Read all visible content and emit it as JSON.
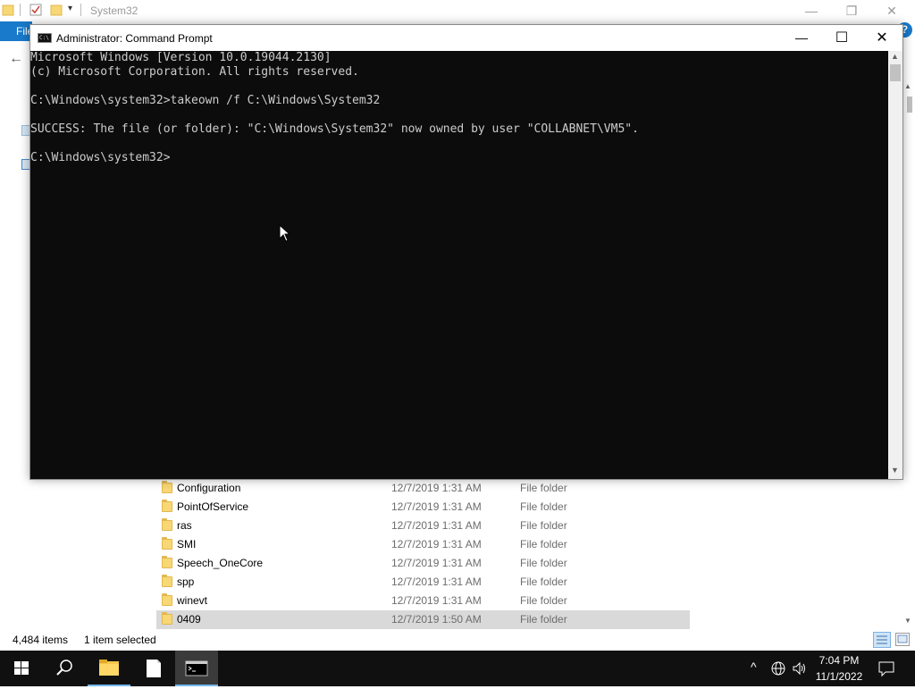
{
  "explorer": {
    "title": "System32",
    "ribbon_file_tab": "File",
    "help_label": "?",
    "back_label": "←",
    "window_controls": {
      "minimize": "—",
      "restore": "❐",
      "close": "✕"
    },
    "files": [
      {
        "name": "Configuration",
        "date": "12/7/2019 1:31 AM",
        "type": "File folder"
      },
      {
        "name": "PointOfService",
        "date": "12/7/2019 1:31 AM",
        "type": "File folder"
      },
      {
        "name": "ras",
        "date": "12/7/2019 1:31 AM",
        "type": "File folder"
      },
      {
        "name": "SMI",
        "date": "12/7/2019 1:31 AM",
        "type": "File folder"
      },
      {
        "name": "Speech_OneCore",
        "date": "12/7/2019 1:31 AM",
        "type": "File folder"
      },
      {
        "name": "spp",
        "date": "12/7/2019 1:31 AM",
        "type": "File folder"
      },
      {
        "name": "winevt",
        "date": "12/7/2019 1:31 AM",
        "type": "File folder"
      },
      {
        "name": "0409",
        "date": "12/7/2019 1:50 AM",
        "type": "File folder",
        "selected": true
      }
    ],
    "status": {
      "item_count": "4,484 items",
      "selected": "1 item selected"
    }
  },
  "cmd": {
    "title": "Administrator: Command Prompt",
    "icon_text": "C:\\",
    "controls": {
      "minimize": "—",
      "maximize": "☐",
      "close": "✕"
    },
    "lines": [
      "Microsoft Windows [Version 10.0.19044.2130]",
      "(c) Microsoft Corporation. All rights reserved.",
      "",
      "C:\\Windows\\system32>takeown /f C:\\Windows\\System32",
      "",
      "SUCCESS: The file (or folder): \"C:\\Windows\\System32\" now owned by user \"COLLABNET\\VM5\".",
      "",
      "C:\\Windows\\system32>"
    ]
  },
  "taskbar": {
    "items": [
      {
        "name": "start-button",
        "icon": "windows-logo-icon"
      },
      {
        "name": "search-button",
        "icon": "search-icon"
      },
      {
        "name": "file-explorer-button",
        "icon": "folder-icon"
      },
      {
        "name": "notepad-button",
        "icon": "document-icon"
      },
      {
        "name": "command-prompt-button",
        "icon": "cmd-icon",
        "active": true
      }
    ],
    "tray": {
      "chevron": "^",
      "time": "7:04 PM",
      "date": "11/1/2022"
    }
  },
  "colors": {
    "taskbar": "#101010",
    "console_bg": "#0c0c0c",
    "console_text": "#cccccc",
    "accent": "#1979ca",
    "selected_row": "#d9d9d9"
  }
}
